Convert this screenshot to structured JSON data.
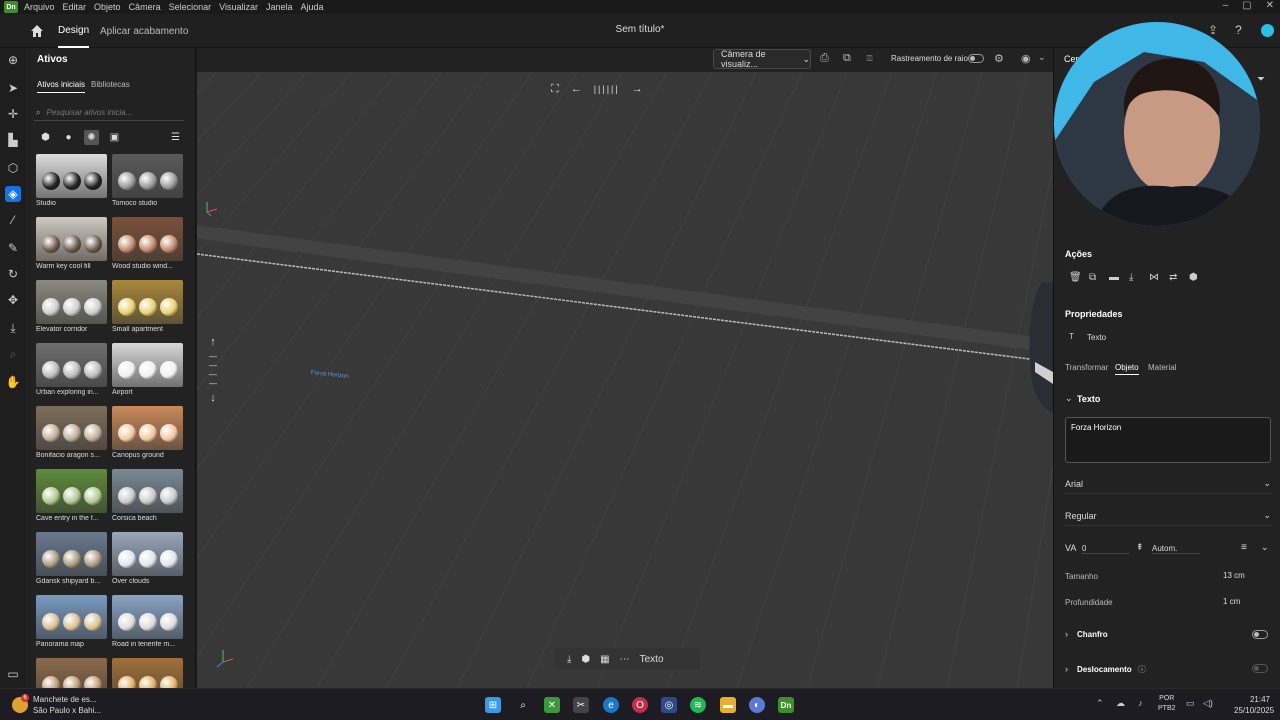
{
  "menubar": {
    "app_badge": "Dn",
    "items": [
      "Arquivo",
      "Editar",
      "Objeto",
      "Câmera",
      "Selecionar",
      "Visualizar",
      "Janela",
      "Ajuda"
    ]
  },
  "topbar": {
    "tab_design": "Design",
    "tab_apply": "Aplicar acabamento",
    "doc_title": "Sem título*"
  },
  "assets": {
    "title": "Ativos",
    "tab_starter": "Ativos iniciais",
    "tab_libraries": "Bibliotecas",
    "search_placeholder": "Pesquisar ativos inicia...",
    "items": [
      {
        "label": "Studio",
        "bg": "#ddd",
        "sp": "#222"
      },
      {
        "label": "Tomoco studio",
        "bg": "#5a5a5a",
        "sp": "#999"
      },
      {
        "label": "Warm key cool fill",
        "bg": "#cfc9c0",
        "sp": "#6b5a4c"
      },
      {
        "label": "Wood studio wind...",
        "bg": "#7a5138",
        "sp": "#c08a6a"
      },
      {
        "label": "Elevator corridor",
        "bg": "#8a8a80",
        "sp": "#ccc"
      },
      {
        "label": "Small apartment",
        "bg": "#a8883a",
        "sp": "#e8d070"
      },
      {
        "label": "Urban exploring in...",
        "bg": "#6e6e6e",
        "sp": "#bbb"
      },
      {
        "label": "Airport",
        "bg": "#d8d8d8",
        "sp": "#f0f0f0"
      },
      {
        "label": "Bonifacio aragon s...",
        "bg": "#7e6e5c",
        "sp": "#bfae96"
      },
      {
        "label": "Canopus ground",
        "bg": "#c88a5a",
        "sp": "#f2c8a0"
      },
      {
        "label": "Cave entry in the f...",
        "bg": "#5f8a3a",
        "sp": "#b0c890"
      },
      {
        "label": "Corsica beach",
        "bg": "#7a8a96",
        "sp": "#c8c8c8"
      },
      {
        "label": "Gdansk shipyard b...",
        "bg": "#6a7a8e",
        "sp": "#a89a80"
      },
      {
        "label": "Over clouds",
        "bg": "#9aa8bc",
        "sp": "#e0e6ee"
      },
      {
        "label": "Panorama map",
        "bg": "#7a9ac0",
        "sp": "#d8c090"
      },
      {
        "label": "Road in tenerife m...",
        "bg": "#8aa4c4",
        "sp": "#dcdcdc"
      },
      {
        "label": "",
        "bg": "#8a6a4a",
        "sp": "#c09a70"
      },
      {
        "label": "",
        "bg": "#a0703a",
        "sp": "#e0b060"
      }
    ]
  },
  "viewport": {
    "camera_select": "Câmera de visualiz...",
    "raytrace_label": "Rastreamento de raio",
    "scene_text": "Forza Horizon"
  },
  "bottom_toolbar": {
    "text_button": "Texto"
  },
  "right_panel": {
    "camera_partial": "Cen",
    "actions_title": "Ações",
    "properties_title": "Propriedades",
    "object_type": "Texto",
    "tabs": {
      "transform": "Transformar",
      "object": "Objeto",
      "material": "Material"
    },
    "text_section": "Texto",
    "text_value": "Forza Horizon",
    "font_family": "Arial",
    "font_style": "Regular",
    "tracking_value": "0",
    "leading_value": "Autom.",
    "size_label": "Tamanho",
    "size_value": "13 cm",
    "depth_label": "Profundidade",
    "depth_value": "1 cm",
    "bevel_label": "Chanfro",
    "offset_label": "Deslocamento"
  },
  "taskbar": {
    "news_line1": "Manchete de es...",
    "news_line2": "São Paulo x Bahi...",
    "news_badge": "6",
    "lang_top": "POR",
    "lang_bottom": "PTB2",
    "time": "21:47",
    "date": "25/10/2025"
  }
}
